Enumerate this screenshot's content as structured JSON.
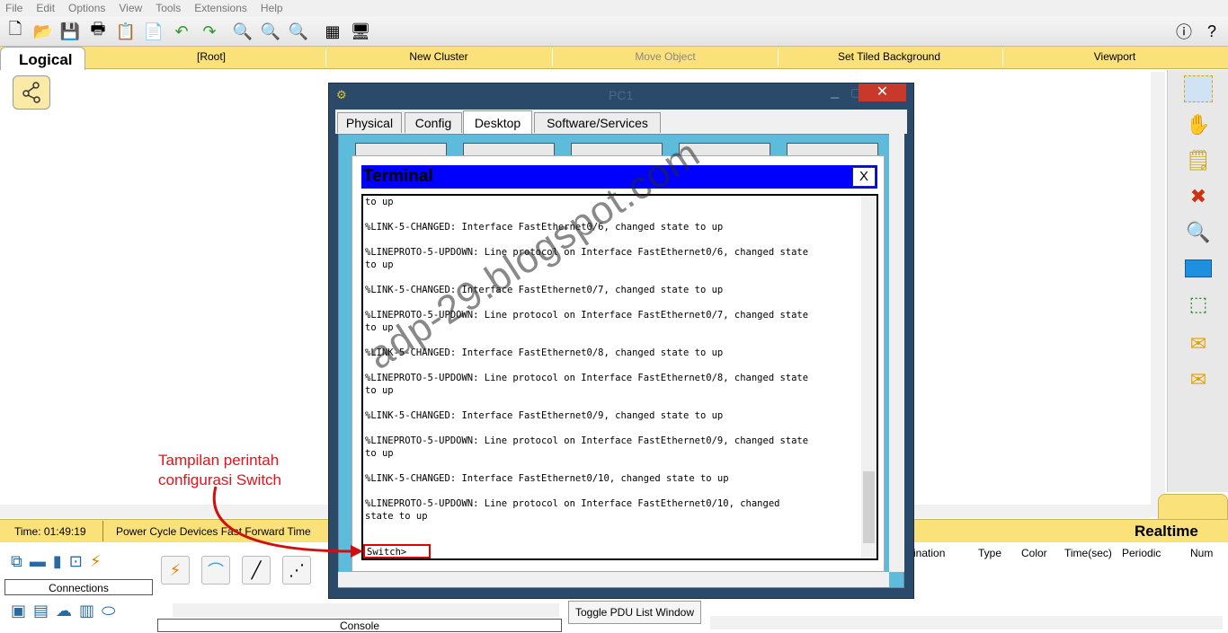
{
  "menu": [
    "File",
    "Edit",
    "Options",
    "View",
    "Tools",
    "Extensions",
    "Help"
  ],
  "logical_bar": {
    "tab": "Logical",
    "root": "[Root]",
    "new_cluster": "New Cluster",
    "move_object": "Move Object",
    "set_tiled_background": "Set Tiled Background",
    "viewport": "Viewport"
  },
  "time_bar": {
    "time": "Time: 01:49:19",
    "power": "Power Cycle Devices   Fast Forward Time",
    "mode": "Realtime"
  },
  "bottom": {
    "connections_label": "Connections",
    "console_label": "Console",
    "toggle_pdu": "Toggle PDU List Window",
    "pdu_headers": [
      "ination",
      "Type",
      "Color",
      "Time(sec)",
      "Periodic",
      "Num"
    ]
  },
  "pc_window": {
    "title": "PC1",
    "tabs": [
      "Physical",
      "Config",
      "Desktop",
      "Software/Services"
    ],
    "active_tab": "Desktop"
  },
  "terminal": {
    "title": "Terminal",
    "close": "X",
    "lines": "to up\n\n%LINK-5-CHANGED: Interface FastEthernet0/6, changed state to up\n\n%LINEPROTO-5-UPDOWN: Line protocol on Interface FastEthernet0/6, changed state\nto up\n\n%LINK-5-CHANGED: Interface FastEthernet0/7, changed state to up\n\n%LINEPROTO-5-UPDOWN: Line protocol on Interface FastEthernet0/7, changed state\nto up\n\n%LINK-5-CHANGED: Interface FastEthernet0/8, changed state to up\n\n%LINEPROTO-5-UPDOWN: Line protocol on Interface FastEthernet0/8, changed state\nto up\n\n%LINK-5-CHANGED: Interface FastEthernet0/9, changed state to up\n\n%LINEPROTO-5-UPDOWN: Line protocol on Interface FastEthernet0/9, changed state\nto up\n\n%LINK-5-CHANGED: Interface FastEthernet0/10, changed state to up\n\n%LINEPROTO-5-UPDOWN: Line protocol on Interface FastEthernet0/10, changed\nstate to up\n\n\n",
    "prompt": "Switch>"
  },
  "annotation": {
    "line1": "Tampilan perintah",
    "line2": "configurasi Switch",
    "color": "#e8101e"
  },
  "watermark": "adp-29.blogspot.com",
  "colors": {
    "toolbar_yellow": "#fbe17a",
    "terminal_title": "#0000ff",
    "close_red": "#c8392b",
    "desktop_bg": "#5dbcdc"
  }
}
